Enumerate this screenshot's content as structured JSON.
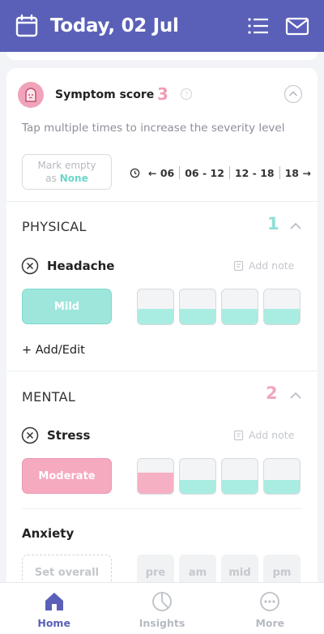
{
  "header": {
    "title": "Today, 02 Jul",
    "icons": [
      "calendar-icon",
      "list-icon",
      "mail-icon"
    ],
    "bg_color": "#5a60b8"
  },
  "symptom_score": {
    "title": "Symptom score",
    "value": "3",
    "hint": "Tap multiple times to increase the severity level",
    "mark_empty_line1": "Mark empty",
    "mark_empty_as": "as",
    "mark_empty_none": "None",
    "time_ranges": [
      "← 06",
      "06 - 12",
      "12 - 18",
      "18 →"
    ]
  },
  "physical": {
    "title": "PHYSICAL",
    "count": "1",
    "count_color": "#8fe0d6",
    "symptom": {
      "name": "Headache",
      "add_note": "Add note",
      "severity_label": "Mild",
      "severity_levels": [
        0.45,
        0.45,
        0.45,
        0.45
      ]
    },
    "add_edit": "+ Add/Edit"
  },
  "mental": {
    "title": "MENTAL",
    "count": "2",
    "count_color": "#f3a6bd",
    "symptom": {
      "name": "Stress",
      "add_note": "Add note",
      "severity_label": "Moderate",
      "severity_levels": [
        0.6,
        0.4,
        0.4,
        0.4
      ]
    },
    "anxiety": {
      "name": "Anxiety",
      "set_overall": "Set overall",
      "slots": [
        "pre",
        "am",
        "mid",
        "pm"
      ]
    }
  },
  "tabs": [
    {
      "label": "Home",
      "icon": "home-icon",
      "active": true
    },
    {
      "label": "Insights",
      "icon": "insights-icon",
      "active": false
    },
    {
      "label": "More",
      "icon": "more-icon",
      "active": false
    }
  ],
  "colors": {
    "accent": "#5a60b8",
    "teal": "#9ee6dc",
    "pink": "#f5aac0"
  }
}
